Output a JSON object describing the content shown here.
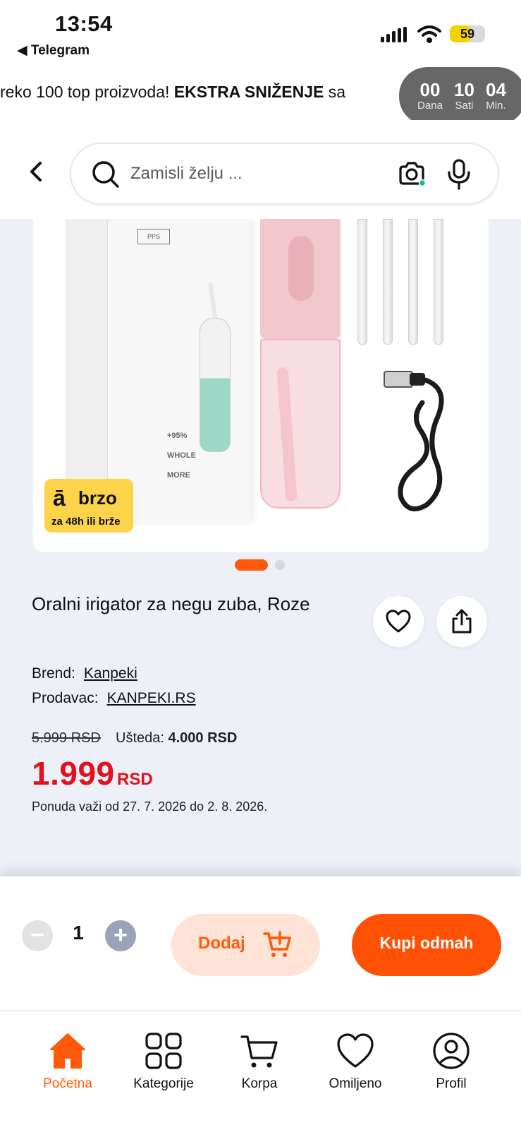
{
  "status_bar": {
    "time": "13:54",
    "back_app": "◀ Telegram",
    "battery": "59",
    "battery_fraction": 0.59
  },
  "promo": {
    "text_before": "reko 100 top proizvoda! ",
    "text_bold": "EKSTRA SNIŽENJE",
    "text_after": " sa",
    "countdown": [
      {
        "value": "00",
        "label": "Dana"
      },
      {
        "value": "10",
        "label": "Sati"
      },
      {
        "value": "04",
        "label": "Min."
      }
    ]
  },
  "search": {
    "placeholder": "Zamisli želju ..."
  },
  "product": {
    "image_badge": {
      "logo": "ā",
      "title": "brzo",
      "subtitle": "za 48h ili brže"
    },
    "image_box_text": {
      "label": "PPS",
      "lines": [
        "+95%",
        "WHOLE",
        "MORE"
      ]
    },
    "carousel": {
      "count": 2,
      "active": 0
    },
    "title": "Oralni irigator za negu zuba, Roze",
    "brand_label": "Brend:",
    "brand": "Kanpeki",
    "seller_label": "Prodavac:",
    "seller": "KANPEKI.RS",
    "old_price": "5.999 RSD",
    "saving_label": "Ušteda:",
    "saving_value": "4.000 RSD",
    "price": "1.999",
    "currency": "RSD",
    "validity": "Ponuda važi od 27. 7. 2026 do 2. 8. 2026."
  },
  "buy_bar": {
    "quantity": "1",
    "minus": "−",
    "plus": "+",
    "add_label": "Dodaj",
    "buy_label": "Kupi odmah"
  },
  "nav": {
    "items": [
      {
        "label": "Početna",
        "icon": "home-icon",
        "active": true
      },
      {
        "label": "Kategorije",
        "icon": "grid-icon",
        "active": false
      },
      {
        "label": "Korpa",
        "icon": "cart-icon",
        "active": false
      },
      {
        "label": "Omiljeno",
        "icon": "heart-icon",
        "active": false
      },
      {
        "label": "Profil",
        "icon": "profile-icon",
        "active": false
      }
    ]
  },
  "colors": {
    "accent": "#ff5a0a",
    "price": "#e3101d",
    "page_bg": "#edf0f7",
    "badge": "#fcd44a"
  }
}
